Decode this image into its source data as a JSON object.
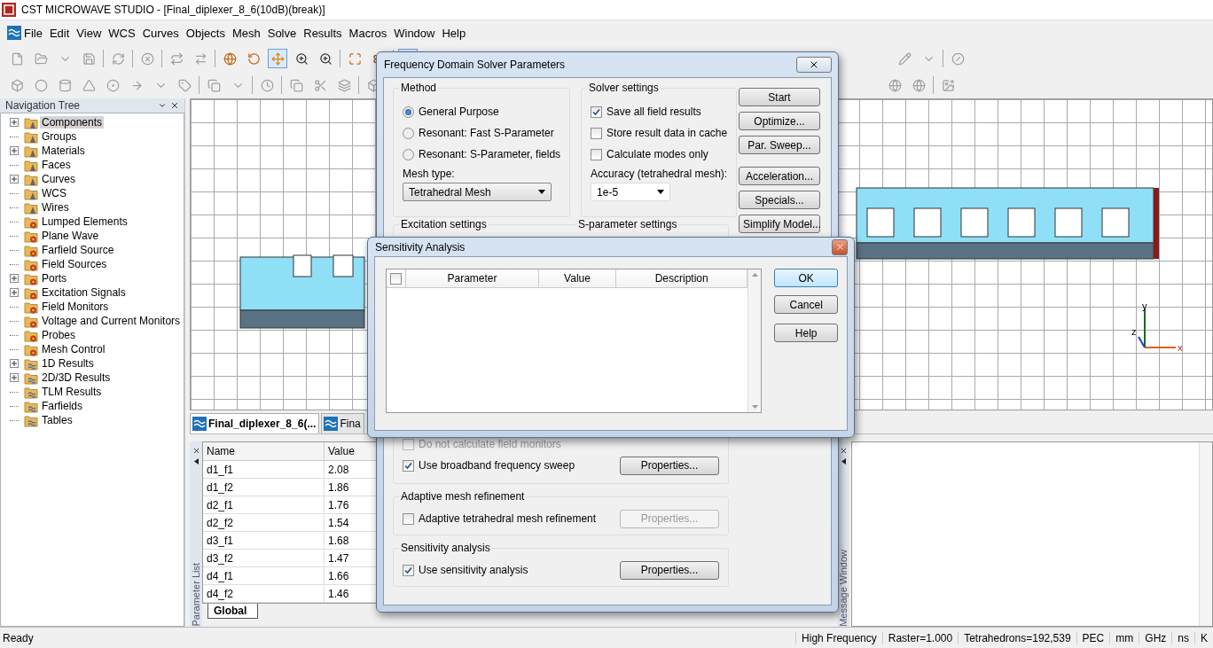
{
  "window": {
    "title": "CST MICROWAVE STUDIO - [Final_diplexer_8_6(10dB)(break)]"
  },
  "menu": [
    "File",
    "Edit",
    "View",
    "WCS",
    "Curves",
    "Objects",
    "Mesh",
    "Solve",
    "Results",
    "Macros",
    "Window",
    "Help"
  ],
  "navigation_tree": {
    "title": "Navigation Tree",
    "items": [
      {
        "label": "Components",
        "kind": "shape",
        "expandable": true,
        "selected": true
      },
      {
        "label": "Groups",
        "kind": "shape",
        "expandable": false,
        "selected": false
      },
      {
        "label": "Materials",
        "kind": "shape",
        "expandable": true,
        "selected": false
      },
      {
        "label": "Faces",
        "kind": "shape",
        "expandable": false,
        "selected": false
      },
      {
        "label": "Curves",
        "kind": "shape",
        "expandable": true,
        "selected": false
      },
      {
        "label": "WCS",
        "kind": "shape",
        "expandable": false,
        "selected": false
      },
      {
        "label": "Wires",
        "kind": "shape",
        "expandable": false,
        "selected": false
      },
      {
        "label": "Lumped Elements",
        "kind": "source",
        "expandable": false,
        "selected": false
      },
      {
        "label": "Plane Wave",
        "kind": "source",
        "expandable": false,
        "selected": false
      },
      {
        "label": "Farfield Source",
        "kind": "source",
        "expandable": false,
        "selected": false
      },
      {
        "label": "Field Sources",
        "kind": "source",
        "expandable": false,
        "selected": false
      },
      {
        "label": "Ports",
        "kind": "source",
        "expandable": true,
        "selected": false
      },
      {
        "label": "Excitation Signals",
        "kind": "source",
        "expandable": true,
        "selected": false
      },
      {
        "label": "Field Monitors",
        "kind": "source",
        "expandable": false,
        "selected": false
      },
      {
        "label": "Voltage and Current Monitors",
        "kind": "source",
        "expandable": false,
        "selected": false
      },
      {
        "label": "Probes",
        "kind": "source",
        "expandable": false,
        "selected": false
      },
      {
        "label": "Mesh Control",
        "kind": "source",
        "expandable": false,
        "selected": false
      },
      {
        "label": "1D Results",
        "kind": "result",
        "expandable": true,
        "selected": false
      },
      {
        "label": "2D/3D Results",
        "kind": "result",
        "expandable": true,
        "selected": false
      },
      {
        "label": "TLM Results",
        "kind": "result",
        "expandable": false,
        "selected": false
      },
      {
        "label": "Farfields",
        "kind": "result",
        "expandable": false,
        "selected": false
      },
      {
        "label": "Tables",
        "kind": "result",
        "expandable": false,
        "selected": false
      }
    ]
  },
  "viewport": {
    "axes": {
      "x": "x",
      "y": "y",
      "z": "z"
    }
  },
  "document_tabs": [
    {
      "label": "Final_diplexer_8_6(...",
      "selected": true
    },
    {
      "label": "Fina",
      "selected": false
    }
  ],
  "parameter_list": {
    "title": "Parameter List",
    "columns": [
      "Name",
      "Value"
    ],
    "rows": [
      [
        "d1_f1",
        "2.08"
      ],
      [
        "d1_f2",
        "1.86"
      ],
      [
        "d2_f1",
        "1.76"
      ],
      [
        "d2_f2",
        "1.54"
      ],
      [
        "d3_f1",
        "1.68"
      ],
      [
        "d3_f2",
        "1.47"
      ],
      [
        "d4_f1",
        "1.66"
      ],
      [
        "d4_f2",
        "1.46"
      ]
    ],
    "sheet_tab": "Global"
  },
  "message_window": {
    "title": "Message Window"
  },
  "solver_dialog": {
    "title": "Frequency Domain Solver Parameters",
    "method": {
      "title": "Method",
      "options": [
        {
          "label": "General Purpose",
          "selected": true
        },
        {
          "label": "Resonant: Fast S-Parameter",
          "selected": false
        },
        {
          "label": "Resonant: S-Parameter, fields",
          "selected": false
        }
      ],
      "mesh_type_label": "Mesh type:",
      "mesh_type": "Tetrahedral Mesh"
    },
    "solver_settings": {
      "title": "Solver settings",
      "checks": [
        {
          "label": "Save all field results",
          "checked": true
        },
        {
          "label": "Store result data in cache",
          "checked": false
        },
        {
          "label": "Calculate modes only",
          "checked": false
        }
      ],
      "accuracy_label": "Accuracy (tetrahedral mesh):",
      "accuracy": "1e-5"
    },
    "buttons": [
      "Start",
      "Optimize...",
      "Par. Sweep...",
      "Acceleration...",
      "Specials...",
      "Simplify Model..."
    ],
    "excitation_title": "Excitation settings",
    "s_parameter_title": "S-parameter settings",
    "lower_checks": [
      {
        "label": "Do not calculate field monitors",
        "checked": false,
        "disabled": true
      },
      {
        "label": "Use broadband frequency sweep",
        "checked": true,
        "disabled": false
      }
    ],
    "lower_button": {
      "label": "Properties...",
      "disabled": false
    },
    "adaptive": {
      "title": "Adaptive mesh refinement",
      "check": {
        "label": "Adaptive tetrahedral mesh refinement",
        "checked": false,
        "disabled": false
      },
      "button": {
        "label": "Properties...",
        "disabled": true
      }
    },
    "sensitivity": {
      "title": "Sensitivity analysis",
      "check": {
        "label": "Use sensitivity analysis",
        "checked": true,
        "disabled": false
      },
      "button": {
        "label": "Properties...",
        "disabled": false
      }
    }
  },
  "sensitivity_dialog": {
    "title": "Sensitivity Analysis",
    "select_all_checked": false,
    "columns": [
      "Parameter",
      "Value",
      "Description"
    ],
    "buttons": [
      {
        "label": "OK",
        "default": true
      },
      {
        "label": "Cancel",
        "default": false
      },
      {
        "label": "Help",
        "default": false
      }
    ]
  },
  "status_bar": {
    "left": "Ready",
    "right": [
      "High Frequency",
      "Raster=1.000",
      "Tetrahedrons=192,539",
      "PEC",
      "mm",
      "GHz",
      "ns",
      "K"
    ]
  }
}
